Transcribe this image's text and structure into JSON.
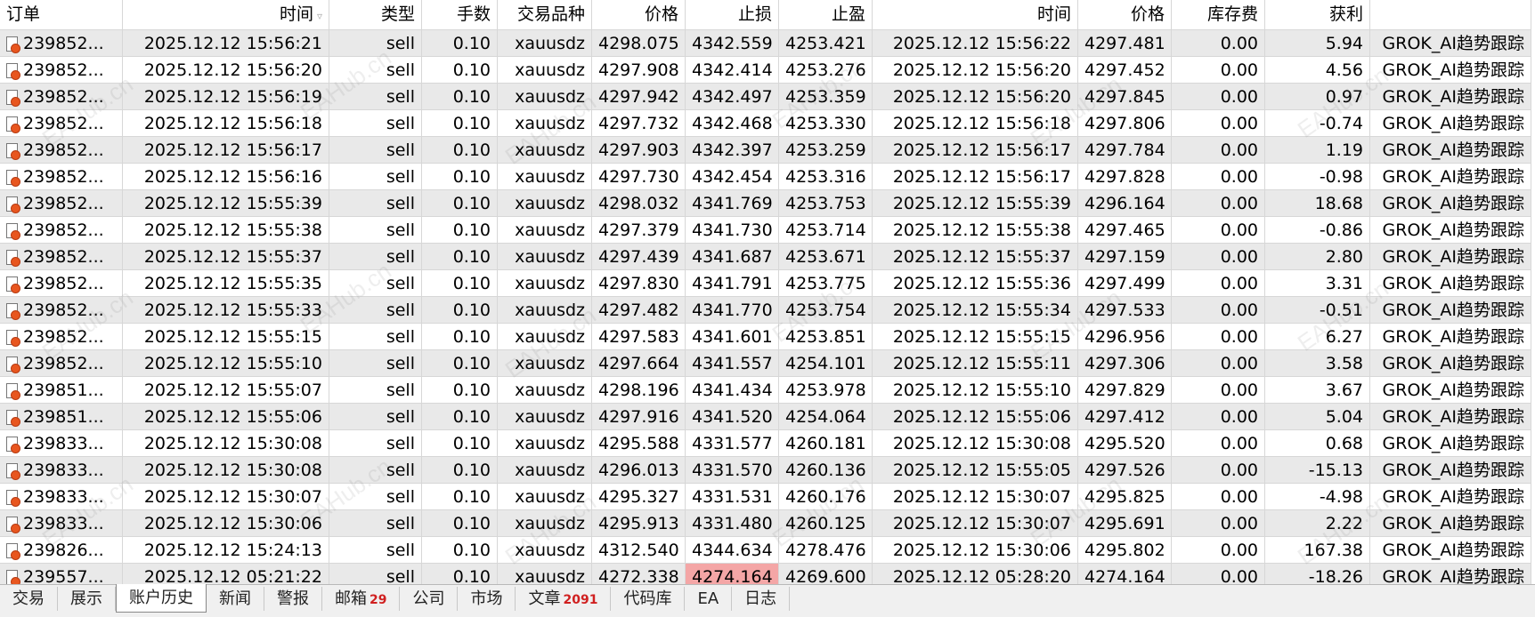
{
  "columns": [
    "订单",
    "时间",
    "类型",
    "手数",
    "交易品种",
    "价格",
    "止损",
    "止盈",
    "时间",
    "价格",
    "库存费",
    "获利",
    ""
  ],
  "rows": [
    [
      "239852...",
      "2025.12.12 15:56:21",
      "sell",
      "0.10",
      "xauusdz",
      "4298.075",
      "4342.559",
      "4253.421",
      "2025.12.12 15:56:22",
      "4297.481",
      "0.00",
      "5.94",
      "GROK_AI趋势跟踪"
    ],
    [
      "239852...",
      "2025.12.12 15:56:20",
      "sell",
      "0.10",
      "xauusdz",
      "4297.908",
      "4342.414",
      "4253.276",
      "2025.12.12 15:56:20",
      "4297.452",
      "0.00",
      "4.56",
      "GROK_AI趋势跟踪"
    ],
    [
      "239852...",
      "2025.12.12 15:56:19",
      "sell",
      "0.10",
      "xauusdz",
      "4297.942",
      "4342.497",
      "4253.359",
      "2025.12.12 15:56:20",
      "4297.845",
      "0.00",
      "0.97",
      "GROK_AI趋势跟踪"
    ],
    [
      "239852...",
      "2025.12.12 15:56:18",
      "sell",
      "0.10",
      "xauusdz",
      "4297.732",
      "4342.468",
      "4253.330",
      "2025.12.12 15:56:18",
      "4297.806",
      "0.00",
      "-0.74",
      "GROK_AI趋势跟踪"
    ],
    [
      "239852...",
      "2025.12.12 15:56:17",
      "sell",
      "0.10",
      "xauusdz",
      "4297.903",
      "4342.397",
      "4253.259",
      "2025.12.12 15:56:17",
      "4297.784",
      "0.00",
      "1.19",
      "GROK_AI趋势跟踪"
    ],
    [
      "239852...",
      "2025.12.12 15:56:16",
      "sell",
      "0.10",
      "xauusdz",
      "4297.730",
      "4342.454",
      "4253.316",
      "2025.12.12 15:56:17",
      "4297.828",
      "0.00",
      "-0.98",
      "GROK_AI趋势跟踪"
    ],
    [
      "239852...",
      "2025.12.12 15:55:39",
      "sell",
      "0.10",
      "xauusdz",
      "4298.032",
      "4341.769",
      "4253.753",
      "2025.12.12 15:55:39",
      "4296.164",
      "0.00",
      "18.68",
      "GROK_AI趋势跟踪"
    ],
    [
      "239852...",
      "2025.12.12 15:55:38",
      "sell",
      "0.10",
      "xauusdz",
      "4297.379",
      "4341.730",
      "4253.714",
      "2025.12.12 15:55:38",
      "4297.465",
      "0.00",
      "-0.86",
      "GROK_AI趋势跟踪"
    ],
    [
      "239852...",
      "2025.12.12 15:55:37",
      "sell",
      "0.10",
      "xauusdz",
      "4297.439",
      "4341.687",
      "4253.671",
      "2025.12.12 15:55:37",
      "4297.159",
      "0.00",
      "2.80",
      "GROK_AI趋势跟踪"
    ],
    [
      "239852...",
      "2025.12.12 15:55:35",
      "sell",
      "0.10",
      "xauusdz",
      "4297.830",
      "4341.791",
      "4253.775",
      "2025.12.12 15:55:36",
      "4297.499",
      "0.00",
      "3.31",
      "GROK_AI趋势跟踪"
    ],
    [
      "239852...",
      "2025.12.12 15:55:33",
      "sell",
      "0.10",
      "xauusdz",
      "4297.482",
      "4341.770",
      "4253.754",
      "2025.12.12 15:55:34",
      "4297.533",
      "0.00",
      "-0.51",
      "GROK_AI趋势跟踪"
    ],
    [
      "239852...",
      "2025.12.12 15:55:15",
      "sell",
      "0.10",
      "xauusdz",
      "4297.583",
      "4341.601",
      "4253.851",
      "2025.12.12 15:55:15",
      "4296.956",
      "0.00",
      "6.27",
      "GROK_AI趋势跟踪"
    ],
    [
      "239852...",
      "2025.12.12 15:55:10",
      "sell",
      "0.10",
      "xauusdz",
      "4297.664",
      "4341.557",
      "4254.101",
      "2025.12.12 15:55:11",
      "4297.306",
      "0.00",
      "3.58",
      "GROK_AI趋势跟踪"
    ],
    [
      "239851...",
      "2025.12.12 15:55:07",
      "sell",
      "0.10",
      "xauusdz",
      "4298.196",
      "4341.434",
      "4253.978",
      "2025.12.12 15:55:10",
      "4297.829",
      "0.00",
      "3.67",
      "GROK_AI趋势跟踪"
    ],
    [
      "239851...",
      "2025.12.12 15:55:06",
      "sell",
      "0.10",
      "xauusdz",
      "4297.916",
      "4341.520",
      "4254.064",
      "2025.12.12 15:55:06",
      "4297.412",
      "0.00",
      "5.04",
      "GROK_AI趋势跟踪"
    ],
    [
      "239833...",
      "2025.12.12 15:30:08",
      "sell",
      "0.10",
      "xauusdz",
      "4295.588",
      "4331.577",
      "4260.181",
      "2025.12.12 15:30:08",
      "4295.520",
      "0.00",
      "0.68",
      "GROK_AI趋势跟踪"
    ],
    [
      "239833...",
      "2025.12.12 15:30:08",
      "sell",
      "0.10",
      "xauusdz",
      "4296.013",
      "4331.570",
      "4260.136",
      "2025.12.12 15:55:05",
      "4297.526",
      "0.00",
      "-15.13",
      "GROK_AI趋势跟踪"
    ],
    [
      "239833...",
      "2025.12.12 15:30:07",
      "sell",
      "0.10",
      "xauusdz",
      "4295.327",
      "4331.531",
      "4260.176",
      "2025.12.12 15:30:07",
      "4295.825",
      "0.00",
      "-4.98",
      "GROK_AI趋势跟踪"
    ],
    [
      "239833...",
      "2025.12.12 15:30:06",
      "sell",
      "0.10",
      "xauusdz",
      "4295.913",
      "4331.480",
      "4260.125",
      "2025.12.12 15:30:07",
      "4295.691",
      "0.00",
      "2.22",
      "GROK_AI趋势跟踪"
    ],
    [
      "239826...",
      "2025.12.12 15:24:13",
      "sell",
      "0.10",
      "xauusdz",
      "4312.540",
      "4344.634",
      "4278.476",
      "2025.12.12 15:30:06",
      "4295.802",
      "0.00",
      "167.38",
      "GROK_AI趋势跟踪"
    ],
    [
      "239557...",
      "2025.12.12 05:21:22",
      "sell",
      "0.10",
      "xauusdz",
      "4272.338",
      "4274.164",
      "4269.600",
      "2025.12.12 05:28:20",
      "4274.164",
      "0.00",
      "-18.26",
      "GROK_AI趋势跟踪"
    ]
  ],
  "highlight": {
    "row": 20,
    "col": 6,
    "color": "#f4a6a6"
  },
  "tabs": [
    {
      "label": "交易",
      "badge": ""
    },
    {
      "label": "展示",
      "badge": ""
    },
    {
      "label": "账户历史",
      "badge": "",
      "active": true
    },
    {
      "label": "新闻",
      "badge": ""
    },
    {
      "label": "警报",
      "badge": ""
    },
    {
      "label": "邮箱",
      "badge": "29"
    },
    {
      "label": "公司",
      "badge": ""
    },
    {
      "label": "市场",
      "badge": ""
    },
    {
      "label": "文章",
      "badge": "2091"
    },
    {
      "label": "代码库",
      "badge": ""
    },
    {
      "label": "EA",
      "badge": ""
    },
    {
      "label": "日志",
      "badge": ""
    }
  ],
  "watermark": "EAHub.cn",
  "colors": {
    "alt_row": "#e9e9e9",
    "loss_cell": "#f4a6a6",
    "badge": "#d02020"
  }
}
